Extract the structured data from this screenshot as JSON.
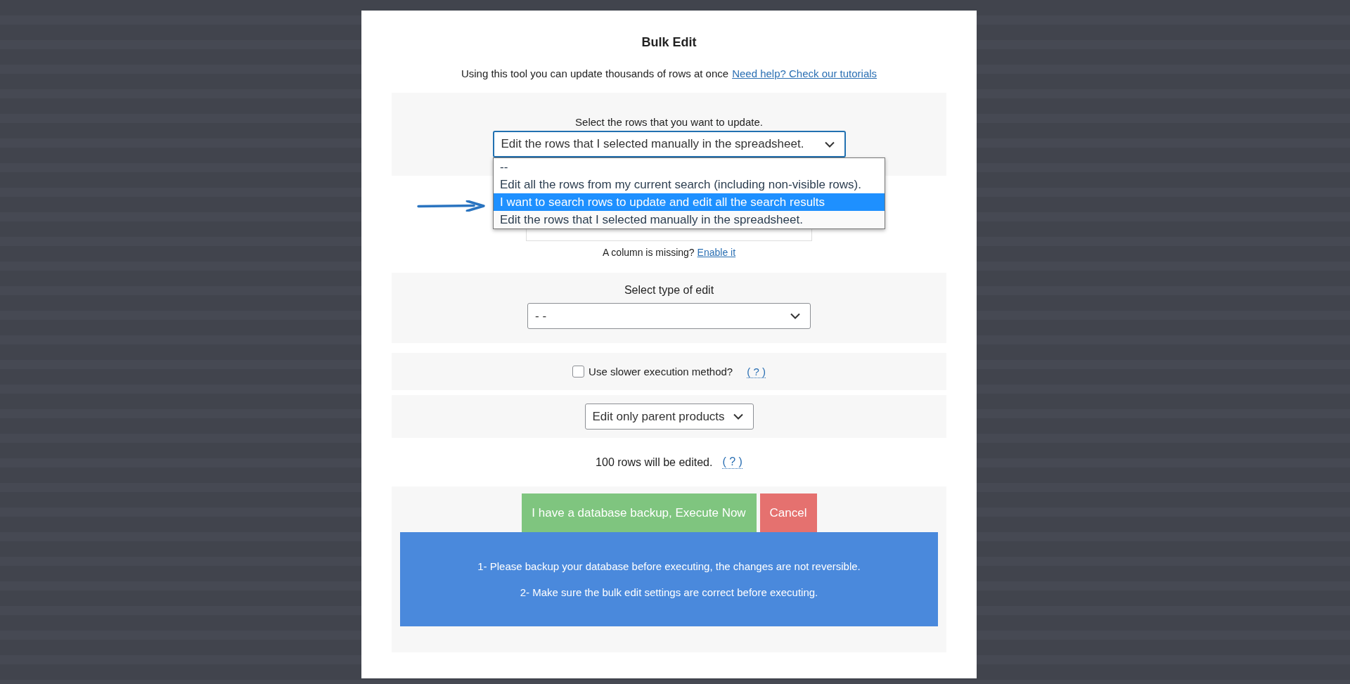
{
  "modal": {
    "title": "Bulk Edit",
    "intro": "Using this tool you can update thousands of rows at once",
    "help_link": "Need help? Check our tutorials",
    "rows_select": {
      "label": "Select the rows that you want to update.",
      "value": "Edit the rows that I selected manually in the spreadsheet.",
      "expanded": true,
      "options": [
        {
          "label": "--",
          "selected": false,
          "highlighted": false
        },
        {
          "label": "Edit all the rows from my current search (including non-visible rows).",
          "selected": false,
          "highlighted": false
        },
        {
          "label": "I want to search rows to update and edit all the search results",
          "selected": false,
          "highlighted": true
        },
        {
          "label": "Edit the rows that I selected manually in the spreadsheet.",
          "selected": true,
          "highlighted": false
        }
      ]
    },
    "column_select": {
      "missing_text": "A column is missing?",
      "enable_link": "Enable it"
    },
    "edit_type": {
      "label": "Select type of edit",
      "value": "- -"
    },
    "slower_method": {
      "label": "Use slower execution method?",
      "checked": false,
      "help": "( ? )"
    },
    "scope_select": {
      "value": "Edit only parent products"
    },
    "rows_count": {
      "text": "100 rows will be edited.",
      "help": "( ? )"
    },
    "buttons": [
      {
        "label": "I have a database backup, Execute Now",
        "kind": "primary"
      },
      {
        "label": "Cancel",
        "kind": "cancel"
      }
    ],
    "notice": [
      "1- Please backup your database before executing, the changes are not reversible.",
      "2- Make sure the bulk edit settings are correct before executing."
    ]
  }
}
